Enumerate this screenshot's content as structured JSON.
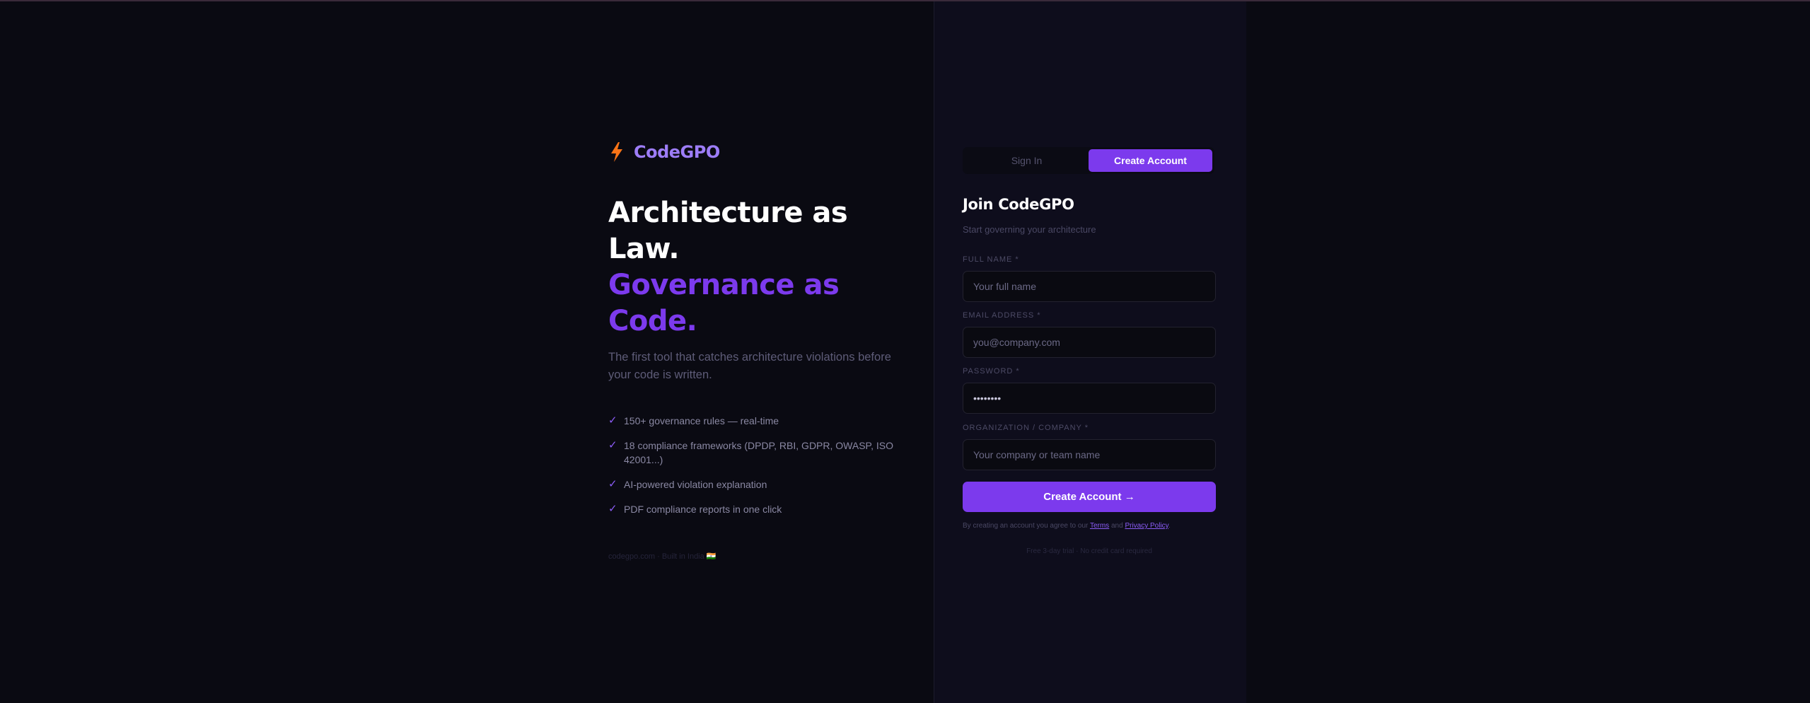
{
  "brand": {
    "name": "CodeGPO",
    "icon": "lightning-bolt-icon",
    "icon_color": "#f97316"
  },
  "hero": {
    "headline_line1": "Architecture as",
    "headline_line2": "Law.",
    "headline_line3": "Governance as",
    "headline_line4": "Code.",
    "subtitle": "The first tool that catches architecture violations before your code is written."
  },
  "features": [
    {
      "icon": "check-icon",
      "text": "150+ governance rules — real-time"
    },
    {
      "icon": "check-icon",
      "text": "18 compliance frameworks (DPDP, RBI, GDPR, OWASP, ISO 42001...)"
    },
    {
      "icon": "check-icon",
      "text": "AI-powered violation explanation"
    },
    {
      "icon": "check-icon",
      "text": "PDF compliance reports in one click"
    }
  ],
  "footer_note": "codegpo.com · Built in India 🇮🇳",
  "auth": {
    "tabs": {
      "sign_in": "Sign In",
      "create_account": "Create Account"
    },
    "title": "Join CodeGPO",
    "subtitle": "Start governing your architecture",
    "fields": {
      "full_name": {
        "label": "FULL NAME *",
        "placeholder": "Your full name",
        "value": ""
      },
      "email": {
        "label": "EMAIL ADDRESS *",
        "placeholder": "you@company.com",
        "value": ""
      },
      "password": {
        "label": "PASSWORD *",
        "placeholder": "",
        "value": "••••••••"
      },
      "organization": {
        "label": "ORGANIZATION / COMPANY *",
        "placeholder": "Your company or team name",
        "value": ""
      }
    },
    "submit_label": "Create Account →",
    "legal_prefix": "By creating an account you agree to our",
    "terms_label": "Terms",
    "and_label": "and",
    "privacy_label": "Privacy Policy",
    "legal_suffix": ".",
    "trial_note": "Free 3-day trial · No credit card required"
  },
  "colors": {
    "accent": "#7c3aed",
    "accent_light": "#9d7df7",
    "background": "#0a0a12",
    "panel": "#0e0d1c"
  }
}
